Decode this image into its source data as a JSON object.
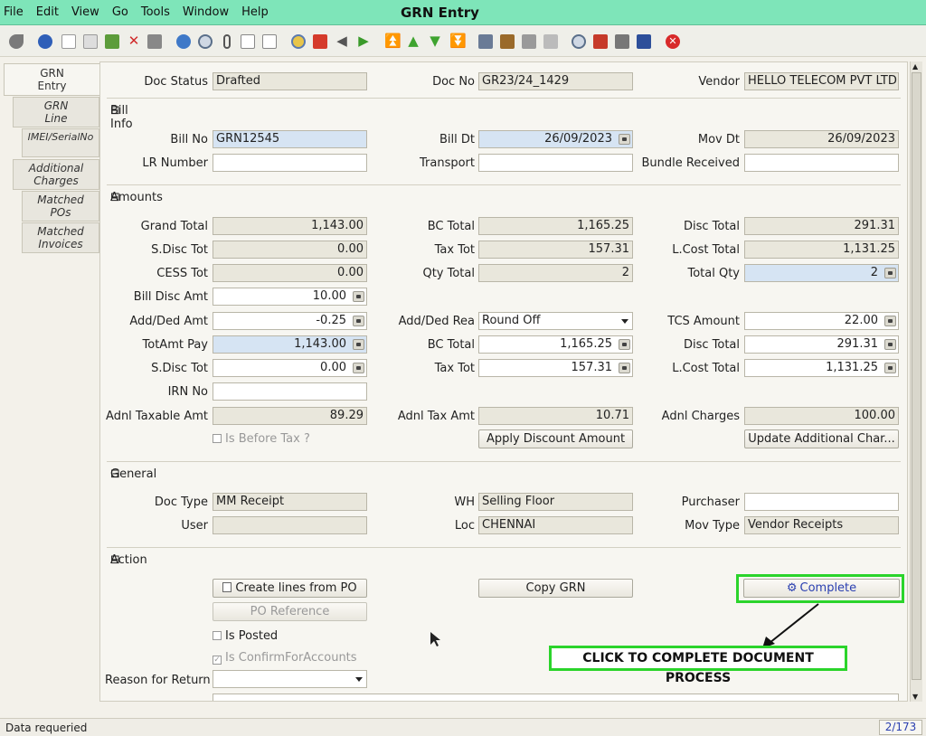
{
  "window": {
    "title": "GRN Entry"
  },
  "menu": [
    {
      "label": "File"
    },
    {
      "label": "Edit"
    },
    {
      "label": "View"
    },
    {
      "label": "Go"
    },
    {
      "label": "Tools"
    },
    {
      "label": "Window"
    },
    {
      "label": "Help"
    }
  ],
  "toolbar_icons": [
    "undo-icon",
    "help-icon",
    "new-icon",
    "copy-icon",
    "save-new-icon",
    "delete-icon",
    "save-icon",
    "refresh-icon",
    "find-icon",
    "attachment-icon",
    "chat-icon",
    "history-icon",
    "home-icon",
    "home-red-icon",
    "previous-arrow-icon",
    "next-arrow-icon",
    "first-record-icon",
    "previous-record-icon",
    "next-record-icon",
    "last-record-icon",
    "report-icon",
    "archive-icon",
    "print-icon",
    "print-preview-icon",
    "zoom-across-icon",
    "workflow-icon",
    "product-info-icon",
    "process-icon",
    "close-window-icon"
  ],
  "tabs": [
    {
      "label": "GRN Entry"
    },
    {
      "label": "GRN Line"
    },
    {
      "label": "IMEI/SerialNo"
    },
    {
      "label": "Additional Charges"
    },
    {
      "label": "Matched POs"
    },
    {
      "label": "Matched Invoices"
    }
  ],
  "header": {
    "doc_status_label": "Doc Status",
    "doc_status": "Drafted",
    "doc_no_label": "Doc No",
    "doc_no": "GR23/24_1429",
    "vendor_label": "Vendor",
    "vendor": "HELLO TELECOM PVT LTD"
  },
  "sections": {
    "bill_info": "Bill Info",
    "amounts": "Amounts",
    "general": "General",
    "action": "Action"
  },
  "bill_info": {
    "bill_no_label": "Bill No",
    "bill_no": "GRN12545",
    "bill_dt_label": "Bill Dt",
    "bill_dt": "26/09/2023",
    "mov_dt_label": "Mov Dt",
    "mov_dt": "26/09/2023",
    "lr_number_label": "LR Number",
    "lr_number": "",
    "transport_label": "Transport",
    "transport": "",
    "bundle_received_label": "Bundle Received",
    "bundle_received": ""
  },
  "amounts": {
    "grand_total_label": "Grand Total",
    "grand_total": "1,143.00",
    "bc_total_label": "BC Total",
    "bc_total": "1,165.25",
    "disc_total_label": "Disc Total",
    "disc_total": "291.31",
    "s_disc_tot_label": "S.Disc Tot",
    "s_disc_tot": "0.00",
    "tax_tot_label": "Tax Tot",
    "tax_tot": "157.31",
    "l_cost_total_label": "L.Cost Total",
    "l_cost_total": "1,131.25",
    "cess_tot_label": "CESS Tot",
    "cess_tot": "0.00",
    "qty_total_label": "Qty Total",
    "qty_total": "2",
    "total_qty_label": "Total Qty",
    "total_qty": "2",
    "bill_disc_amt_label": "Bill Disc Amt",
    "bill_disc_amt": "10.00",
    "add_ded_amt_label": "Add/Ded Amt",
    "add_ded_amt": "-0.25",
    "add_ded_rea_label": "Add/Ded Rea",
    "add_ded_rea": "Round Off",
    "tcs_amount_label": "TCS Amount",
    "tcs_amount": "22.00",
    "totamt_pay_label": "TotAmt Pay",
    "totamt_pay": "1,143.00",
    "bc_total2_label": "BC Total",
    "bc_total2": "1,165.25",
    "disc_total2_label": "Disc Total",
    "disc_total2": "291.31",
    "s_disc_tot2_label": "S.Disc Tot",
    "s_disc_tot2": "0.00",
    "tax_tot2_label": "Tax Tot",
    "tax_tot2": "157.31",
    "l_cost_total2_label": "L.Cost Total",
    "l_cost_total2": "1,131.25",
    "irn_no_label": "IRN No",
    "irn_no": "",
    "adnl_taxable_amt_label": "Adnl Taxable Amt",
    "adnl_taxable_amt": "89.29",
    "adnl_tax_amt_label": "Adnl Tax Amt",
    "adnl_tax_amt": "10.71",
    "adnl_charges_label": "Adnl Charges",
    "adnl_charges": "100.00",
    "is_before_tax_label": "Is Before Tax ?",
    "apply_discount_button": "Apply Discount Amount",
    "update_additional_button": "Update Additional Char..."
  },
  "general": {
    "doc_type_label": "Doc Type",
    "doc_type": "MM Receipt",
    "wh_label": "WH",
    "wh": "Selling Floor",
    "purchaser_label": "Purchaser",
    "purchaser": "",
    "user_label": "User",
    "user": "",
    "loc_label": "Loc",
    "loc": "CHENNAI",
    "mov_type_label": "Mov Type",
    "mov_type": "Vendor Receipts"
  },
  "action": {
    "create_lines_button": "Create lines from PO",
    "copy_grn_button": "Copy GRN",
    "complete_button": "Complete",
    "po_reference_button": "PO Reference",
    "is_posted_label": "Is Posted",
    "is_confirm_label": "Is ConfirmForAccounts",
    "reason_for_return_label": "Reason for Return",
    "reason_for_return": ""
  },
  "annotation": {
    "callout_text": "CLICK TO COMPLETE DOCUMENT PROCESS",
    "highlight_color": "#2bd42b"
  },
  "status": {
    "message": "Data requeried",
    "record_count": "2/173"
  }
}
